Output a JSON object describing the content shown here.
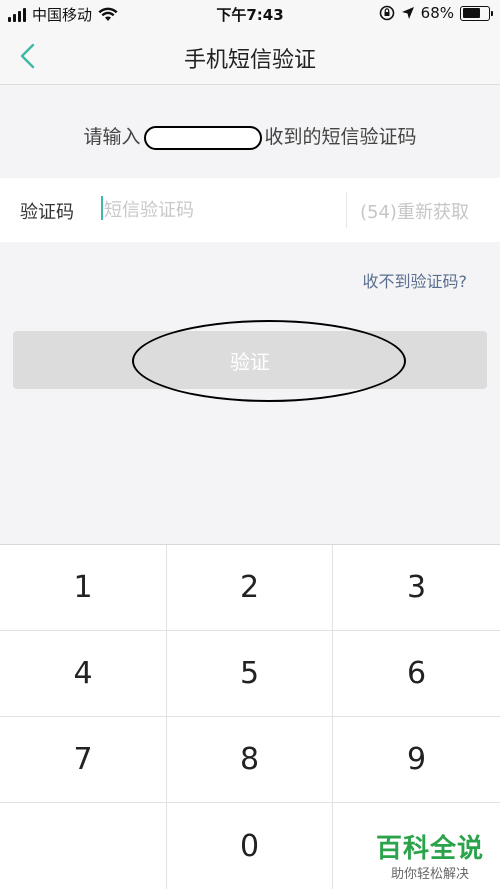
{
  "status_bar": {
    "carrier": "中国移动",
    "time": "下午7:43",
    "battery": "68%",
    "battery_level": 0.68
  },
  "nav": {
    "title": "手机短信验证",
    "back_icon": "chevron-left-icon"
  },
  "prompt": {
    "before": "请输入",
    "after": "收到的短信验证码"
  },
  "code_row": {
    "label": "验证码",
    "placeholder": "短信验证码",
    "value": "",
    "resend": "(54)重新获取"
  },
  "help_link": "收不到验证码?",
  "verify_button": "验证",
  "keypad": {
    "keys": [
      "1",
      "2",
      "3",
      "4",
      "5",
      "6",
      "7",
      "8",
      "9",
      "",
      "0",
      ""
    ]
  },
  "watermark": {
    "title": "百科全说",
    "subtitle": "助你轻松解决"
  },
  "colors": {
    "accent": "#3fb8a6",
    "link": "#5a6f8f",
    "disabled_button": "#dcdcdc",
    "watermark": "#2aa34a"
  }
}
